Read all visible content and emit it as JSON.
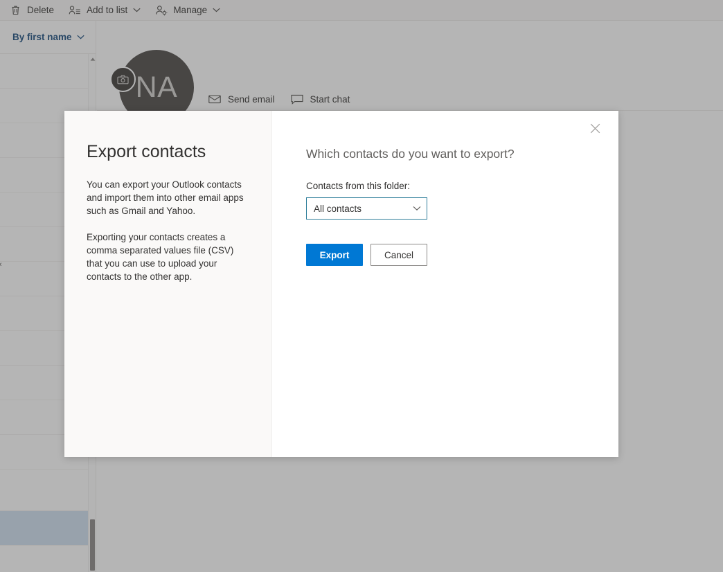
{
  "commandbar": {
    "items": [
      {
        "label": "Delete",
        "icon": "trash-icon",
        "has_caret": false
      },
      {
        "label": "Add to list",
        "icon": "add-to-list-icon",
        "has_caret": true
      },
      {
        "label": "Manage",
        "icon": "manage-person-icon",
        "has_caret": true
      }
    ]
  },
  "list_pane": {
    "sort": {
      "label": "By first name",
      "icon": "chevron-down-icon"
    },
    "rows": [
      {
        "selected": false
      },
      {
        "selected": false
      },
      {
        "selected": false
      },
      {
        "selected": false
      },
      {
        "selected": false
      },
      {
        "selected": false
      },
      {
        "selected": false
      },
      {
        "selected": false
      },
      {
        "selected": false
      },
      {
        "selected": false
      },
      {
        "selected": false
      },
      {
        "selected": false
      },
      {
        "selected": false
      },
      {
        "selected": true
      }
    ],
    "scrollbar": {
      "up_arrow": "scroll-up-arrow-icon"
    },
    "collapse": {
      "icon": "chevron-left-icon",
      "glyph": "‹"
    }
  },
  "contact_detail": {
    "avatar": {
      "initials": "NA",
      "camera_icon": "camera-icon",
      "bg_color": "#4a4644"
    },
    "actions": [
      {
        "label": "Send email",
        "icon": "envelope-icon"
      },
      {
        "label": "Start chat",
        "icon": "chat-bubble-icon"
      }
    ]
  },
  "modal": {
    "title": "Export contacts",
    "paragraphs": [
      "You can export your Outlook contacts and import them into other email apps such as Gmail and Yahoo.",
      "Exporting your contacts creates a comma separated values file (CSV) that you can use to upload your contacts to the other app."
    ],
    "question": "Which contacts do you want to export?",
    "field": {
      "label": "Contacts from this folder:",
      "selected_value": "All contacts",
      "caret_icon": "chevron-down-icon",
      "options": [
        "All contacts"
      ]
    },
    "buttons": {
      "primary": "Export",
      "secondary": "Cancel"
    },
    "close": {
      "icon": "close-icon",
      "glyph": "✕"
    }
  },
  "colors": {
    "accent": "#0078d4",
    "link": "#174a7c",
    "field_border": "#2d7d9a",
    "avatar": "#4a4644",
    "selected_row": "#cfe0f0",
    "panel_bg": "#faf9f8",
    "overlay": "rgba(70,70,70,0.40)"
  }
}
